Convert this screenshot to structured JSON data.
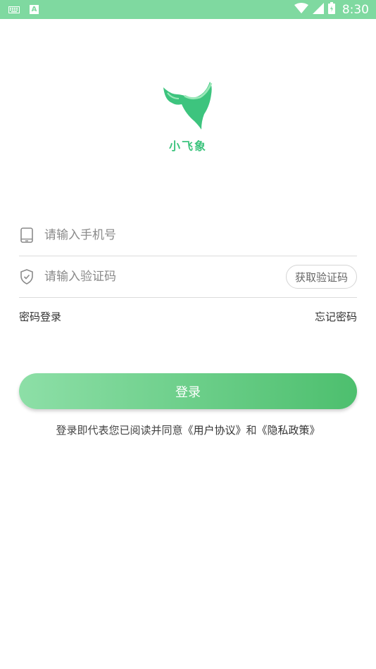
{
  "status_bar": {
    "time": "8:30",
    "icons": [
      "keyboard-icon",
      "a-notification-icon",
      "wifi-icon",
      "signal-icon",
      "battery-icon"
    ]
  },
  "app": {
    "name": "小飞象",
    "logo": "elephant-logo",
    "brand_color": "#3dc47e"
  },
  "form": {
    "phone": {
      "placeholder": "请输入手机号",
      "value": "",
      "icon": "phone-icon"
    },
    "code": {
      "placeholder": "请输入验证码",
      "value": "",
      "icon": "shield-icon"
    },
    "get_code_label": "获取验证码",
    "password_login_label": "密码登录",
    "forgot_password_label": "忘记密码"
  },
  "login_button": {
    "label": "登录"
  },
  "agreement": {
    "prefix": "登录即代表您已阅读并同意",
    "user_agreement": "《用户协议》",
    "and": "和",
    "privacy_policy": "《隐私政策》"
  },
  "colors": {
    "status_bar": "#7fd9a0",
    "button_start": "#8ddfa7",
    "button_end": "#4dbf6e"
  }
}
